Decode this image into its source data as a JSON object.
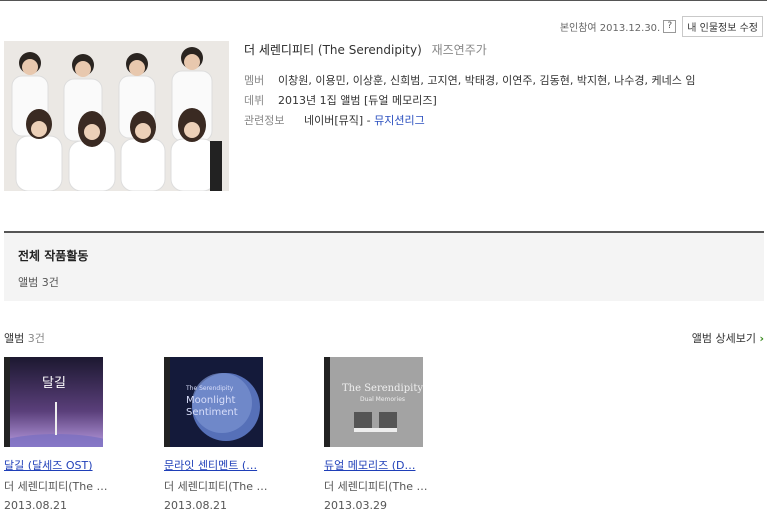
{
  "header": {
    "ref_text": "본인참여 2013.12.30.",
    "help_icon": "?",
    "edit_button": "내 인물정보 수정"
  },
  "profile": {
    "name_kr": "더 세렌디피티",
    "name_en": "(The Serendipity)",
    "role": "재즈연주가",
    "members_label": "멤버",
    "members_value": "이창원, 이용민, 이상훈, 신희범, 고지연, 박태경, 이연주, 김동현, 박지현, 나수경, 케네스 임",
    "debut_label": "데뷔",
    "debut_value": "2013년 1집 앨범 [듀얼 메모리즈]",
    "related_label": "관련정보",
    "related_prefix": "네이버[뮤직] - ",
    "related_link": "뮤지션리그"
  },
  "section": {
    "title": "전체 작품활동",
    "count": "앨범 3건"
  },
  "albums_header": {
    "label": "앨범",
    "count": "3건",
    "more": "앨범 상세보기",
    "more_arrow": "›"
  },
  "albums": [
    {
      "title": "달길 (달세즈 OST)",
      "artist": "더 세렌디피티(The …",
      "date": "2013.08.21",
      "cover_text": "달길"
    },
    {
      "title": "문라잇 센티멘트 (…",
      "artist": "더 세렌디피티(The …",
      "date": "2013.08.21",
      "cover_text": "The Serendipity Moonlight Sentiment"
    },
    {
      "title": "듀얼 메모리즈 (D…",
      "artist": "더 세렌디피티(The …",
      "date": "2013.03.29",
      "cover_text": "The Serendipity Dual Memories"
    }
  ]
}
